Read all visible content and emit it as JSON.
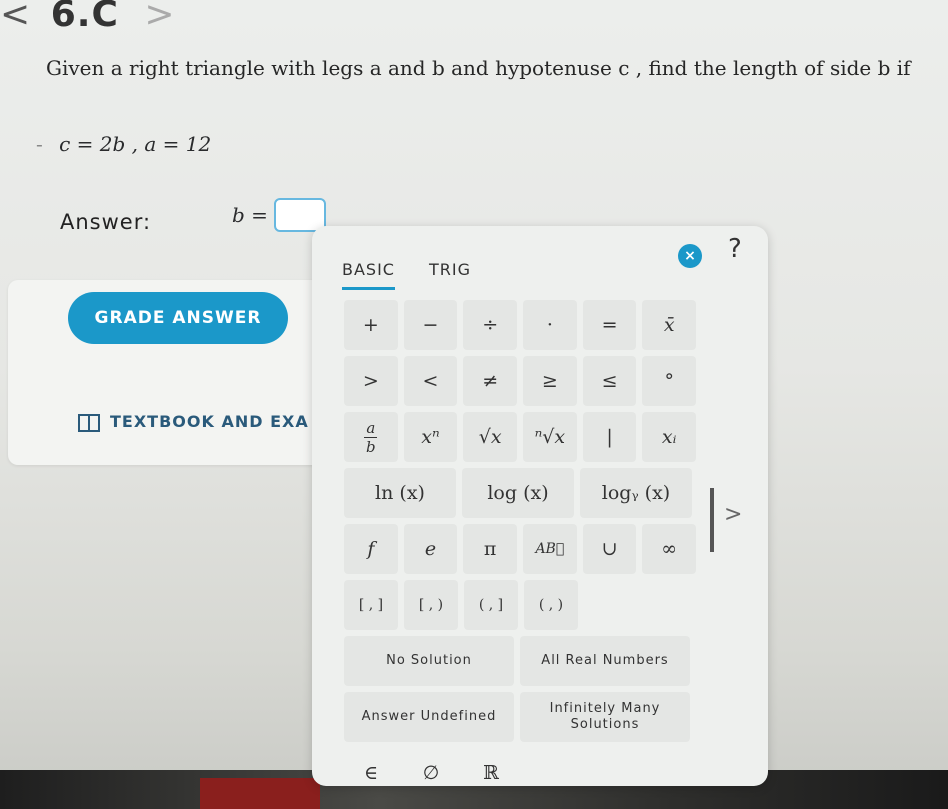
{
  "header": {
    "prefix": "<",
    "section": "6.C",
    "chevron": ">"
  },
  "question": {
    "text": "Given a right triangle with legs a and b  and hypotenuse c , find the length of side b  if",
    "given_dash": "-",
    "given": "c = 2b , a = 12"
  },
  "answer": {
    "label": "Answer:",
    "variable": "b ="
  },
  "left_panel": {
    "grade_button": "GRADE ANSWER",
    "textbook_link": "TEXTBOOK AND EXA"
  },
  "keypad": {
    "tabs": [
      "BASIC",
      "TRIG"
    ],
    "close_symbol": "×",
    "help_symbol": "?",
    "row1": [
      "+",
      "−",
      "÷",
      "·",
      "=",
      "x̄"
    ],
    "row2": [
      ">",
      "<",
      "≠",
      "≥",
      "≤",
      "°"
    ],
    "row3": {
      "frac_top": "a",
      "frac_bottom": "b",
      "power": "xⁿ",
      "sqrt": "√x",
      "nroot": "ⁿ√x",
      "abs": "|",
      "sub": "xᵢ"
    },
    "row4": [
      "ln (x)",
      "log (x)",
      "logᵧ (x)"
    ],
    "row5": [
      "f",
      "e",
      "π",
      "AB⃗",
      "∪",
      "∞"
    ],
    "row6": [
      "[ , ]",
      "[ , )",
      "( , ]",
      "( , )"
    ],
    "row7": [
      "No Solution",
      "All Real Numbers"
    ],
    "row8": [
      "Answer Undefined",
      "Infinitely Many Solutions"
    ],
    "row9": [
      "∈",
      "∅",
      "ℝ"
    ],
    "scroll_arrow": ">"
  }
}
